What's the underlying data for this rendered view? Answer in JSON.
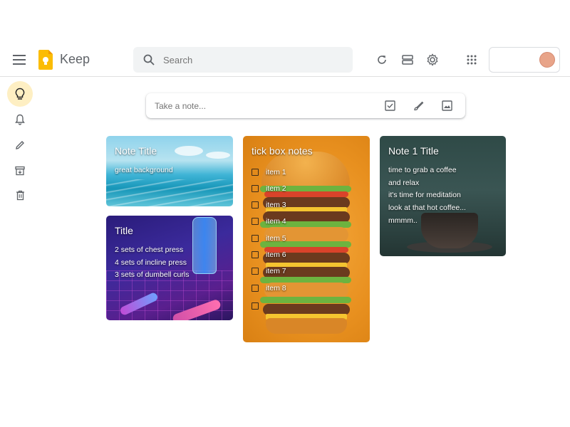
{
  "header": {
    "app_title": "Keep",
    "search_placeholder": "Search"
  },
  "sidebar": {
    "items": [
      {
        "name": "Notes",
        "icon": "lightbulb-icon",
        "active": true
      },
      {
        "name": "Reminders",
        "icon": "bell-icon"
      },
      {
        "name": "Edit labels",
        "icon": "pencil-icon"
      },
      {
        "name": "Archive",
        "icon": "archive-icon"
      },
      {
        "name": "Trash",
        "icon": "trash-icon"
      }
    ]
  },
  "take_note": {
    "placeholder": "Take a note..."
  },
  "notes": [
    {
      "title": "Note Title",
      "lines": [
        "great background"
      ]
    },
    {
      "title": "Title",
      "lines": [
        "2 sets of chest press",
        "4 sets of incline press",
        "3 sets of dumbell curls"
      ]
    },
    {
      "title": "tick box notes",
      "items": [
        "item 1",
        "item 2",
        "item 3",
        "item 4",
        "item 5",
        "item 6",
        "item 7",
        "item 8",
        ""
      ]
    },
    {
      "title": "Note 1 Title",
      "lines": [
        "time to grab a coffee",
        "and relax",
        "it's time for meditation",
        "look at that hot coffee...",
        "mmmm.."
      ]
    }
  ],
  "colors": {
    "accent": "#feefc3",
    "logo_yellow": "#fbbc04",
    "avatar": "#e8a489"
  }
}
